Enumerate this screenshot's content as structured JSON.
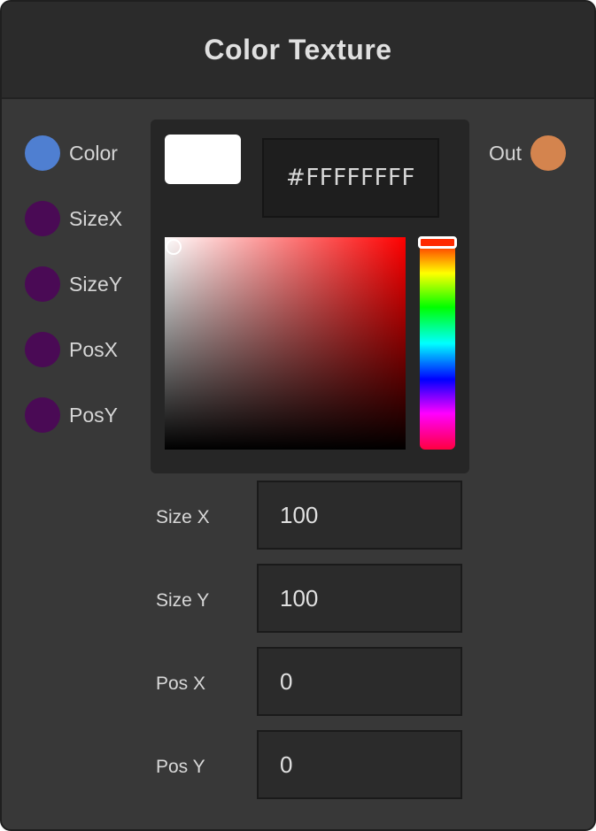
{
  "node": {
    "title": "Color Texture"
  },
  "inputs": [
    {
      "label": "Color",
      "color": "#4f7fd1"
    },
    {
      "label": "SizeX",
      "color": "#4a0a55"
    },
    {
      "label": "SizeY",
      "color": "#4a0a55"
    },
    {
      "label": "PosX",
      "color": "#4a0a55"
    },
    {
      "label": "PosY",
      "color": "#4a0a55"
    }
  ],
  "output": {
    "label": "Out",
    "color": "#d4844e"
  },
  "color_picker": {
    "hex_value": "#FFFFFFFF",
    "selected_color": "#ffffff",
    "hue_color": "#ff0000"
  },
  "fields": [
    {
      "label": "Size X",
      "value": "100"
    },
    {
      "label": "Size Y",
      "value": "100"
    },
    {
      "label": "Pos X",
      "value": "0"
    },
    {
      "label": "Pos Y",
      "value": "0"
    }
  ]
}
